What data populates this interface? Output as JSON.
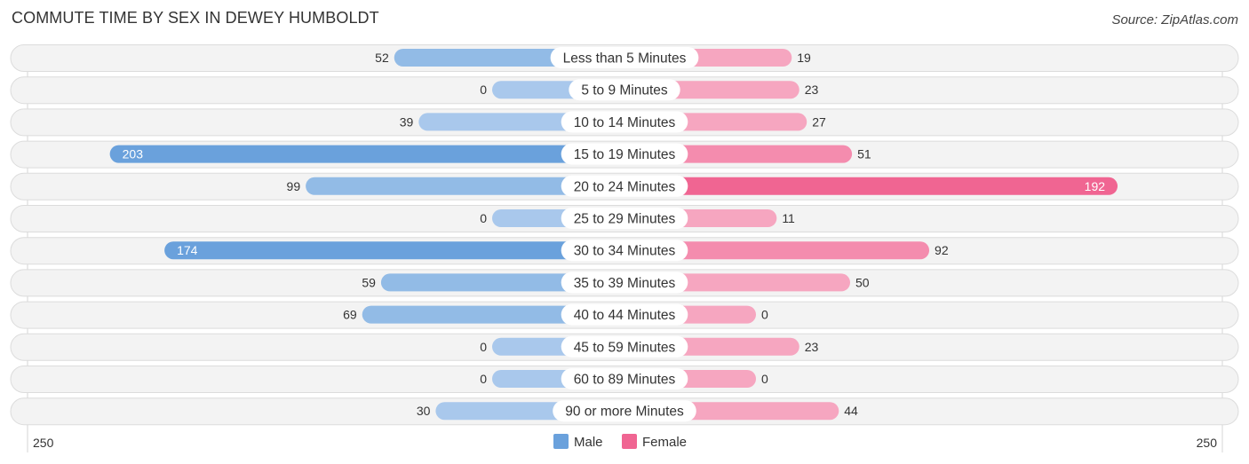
{
  "header": {
    "title": "COMMUTE TIME BY SEX IN DEWEY HUMBOLDT",
    "source": "Source: ZipAtlas.com"
  },
  "chart_data": {
    "type": "bar",
    "orientation": "horizontal-diverging",
    "title": "COMMUTE TIME BY SEX IN DEWEY HUMBOLDT",
    "categories": [
      "Less than 5 Minutes",
      "5 to 9 Minutes",
      "10 to 14 Minutes",
      "15 to 19 Minutes",
      "20 to 24 Minutes",
      "25 to 29 Minutes",
      "30 to 34 Minutes",
      "35 to 39 Minutes",
      "40 to 44 Minutes",
      "45 to 59 Minutes",
      "60 to 89 Minutes",
      "90 or more Minutes"
    ],
    "series": [
      {
        "name": "Male",
        "side": "left",
        "color": "#6aa1dc",
        "color_light": "#a9c8ec",
        "values": [
          52,
          0,
          39,
          203,
          99,
          0,
          174,
          59,
          69,
          0,
          0,
          30
        ]
      },
      {
        "name": "Female",
        "side": "right",
        "color": "#f06592",
        "color_light": "#f6a6c0",
        "values": [
          19,
          23,
          27,
          51,
          192,
          11,
          92,
          50,
          0,
          23,
          0,
          44
        ]
      }
    ],
    "axis": {
      "left_label": "250",
      "right_label": "250",
      "max": 250
    },
    "legend": {
      "position": "bottom-center",
      "items": [
        "Male",
        "Female"
      ]
    },
    "grid": false
  }
}
